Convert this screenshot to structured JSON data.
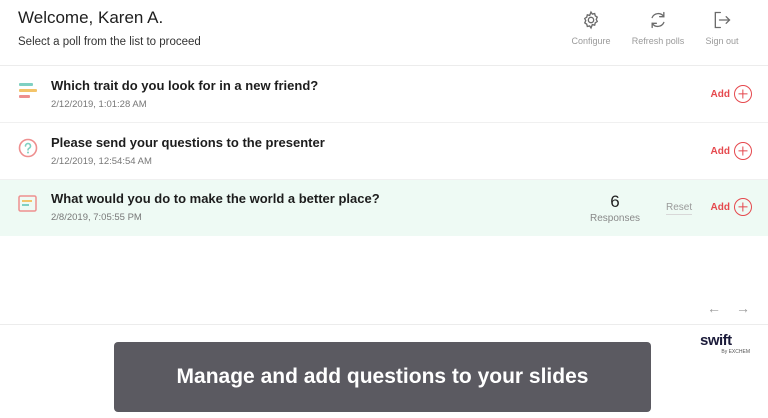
{
  "header": {
    "welcome": "Welcome, Karen A.",
    "subtitle": "Select a poll from the list to proceed",
    "actions": {
      "configure": {
        "label": "Configure",
        "icon": "gear-icon"
      },
      "refresh": {
        "label": "Refresh polls",
        "icon": "refresh-icon"
      },
      "signout": {
        "label": "Sign out",
        "icon": "sign-out-icon"
      }
    }
  },
  "polls": [
    {
      "title": "Which trait do you look for in a new friend?",
      "date": "2/12/2019, 1:01:28 AM",
      "icon": "multiple-choice-icon",
      "add_label": "Add"
    },
    {
      "title": "Please send your questions to the presenter",
      "date": "2/12/2019, 12:54:54 AM",
      "icon": "question-icon",
      "add_label": "Add"
    },
    {
      "title": "What would you do to make the world a better place?",
      "date": "2/8/2019, 7:05:55 PM",
      "icon": "open-text-icon",
      "add_label": "Add",
      "responses_count": "6",
      "responses_label": "Responses",
      "reset_label": "Reset"
    }
  ],
  "pagination": {
    "prev": "←",
    "next": "→"
  },
  "logo": {
    "word": "swift",
    "by": "By EXCHEM"
  },
  "banner": {
    "text": "Manage and add questions to your slides"
  },
  "colors": {
    "accent": "#e5484d",
    "highlight_row": "#eefaf4",
    "banner_bg": "#5b5a61"
  }
}
